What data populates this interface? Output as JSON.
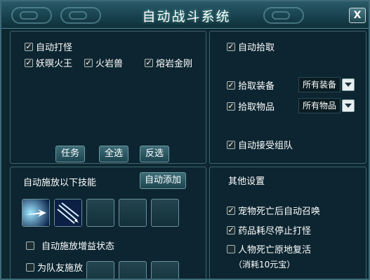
{
  "window": {
    "title": "自动战斗系统",
    "close_label": "X"
  },
  "monster": {
    "auto_fight": "自动打怪",
    "targets": [
      "妖暝火王",
      "火岩兽",
      "熔岩金刚"
    ],
    "buttons": {
      "task": "任务",
      "select_all": "全选",
      "invert": "反选"
    }
  },
  "pickup": {
    "auto_pickup": "自动拾取",
    "equip_label": "拾取装备",
    "equip_value": "所有装备",
    "item_label": "拾取物品",
    "item_value": "所有物品",
    "auto_team": "自动接受组队"
  },
  "skills": {
    "header": "自动施放以下技能",
    "add_button": "自动添加",
    "buff_option": "自动施放增益状态",
    "team_option": "为队友施放"
  },
  "other": {
    "header": "其他设置",
    "pet_summon": "宠物死亡后自动召唤",
    "stop_on_potion": "药品耗尽停止打怪",
    "revive": "人物死亡原地复活",
    "revive_cost": "（消耗10元宝）"
  },
  "checkmark": "✓"
}
